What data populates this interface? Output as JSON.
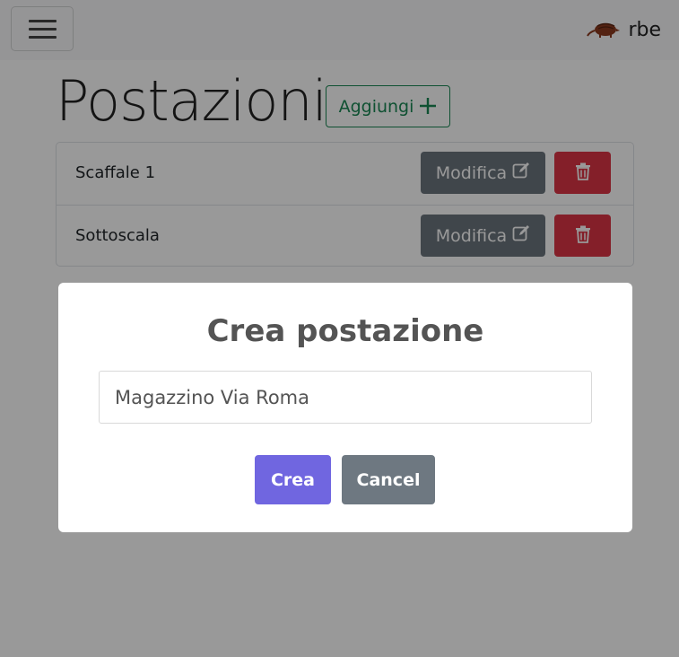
{
  "navbar": {
    "brand_text": "rbe",
    "icons": {
      "menu": "hamburger-menu-icon",
      "logo": "armadillo-logo-icon"
    }
  },
  "page": {
    "title": "Postazioni",
    "add_label": "Aggiungi",
    "add_icon": "plus-icon"
  },
  "locations": [
    {
      "name": "Scaffale 1",
      "edit_label": "Modifica"
    },
    {
      "name": "Sottoscala",
      "edit_label": "Modifica"
    }
  ],
  "row_icons": {
    "edit": "edit-pencil-icon",
    "delete": "trash-icon"
  },
  "modal": {
    "title": "Crea postazione",
    "input_value": "Magazzino Via Roma",
    "confirm_label": "Crea",
    "cancel_label": "Cancel"
  },
  "colors": {
    "success": "#198754",
    "secondary": "#6c757d",
    "danger": "#dc3545",
    "confirm": "#7066e0",
    "cancel": "#6e7881"
  }
}
